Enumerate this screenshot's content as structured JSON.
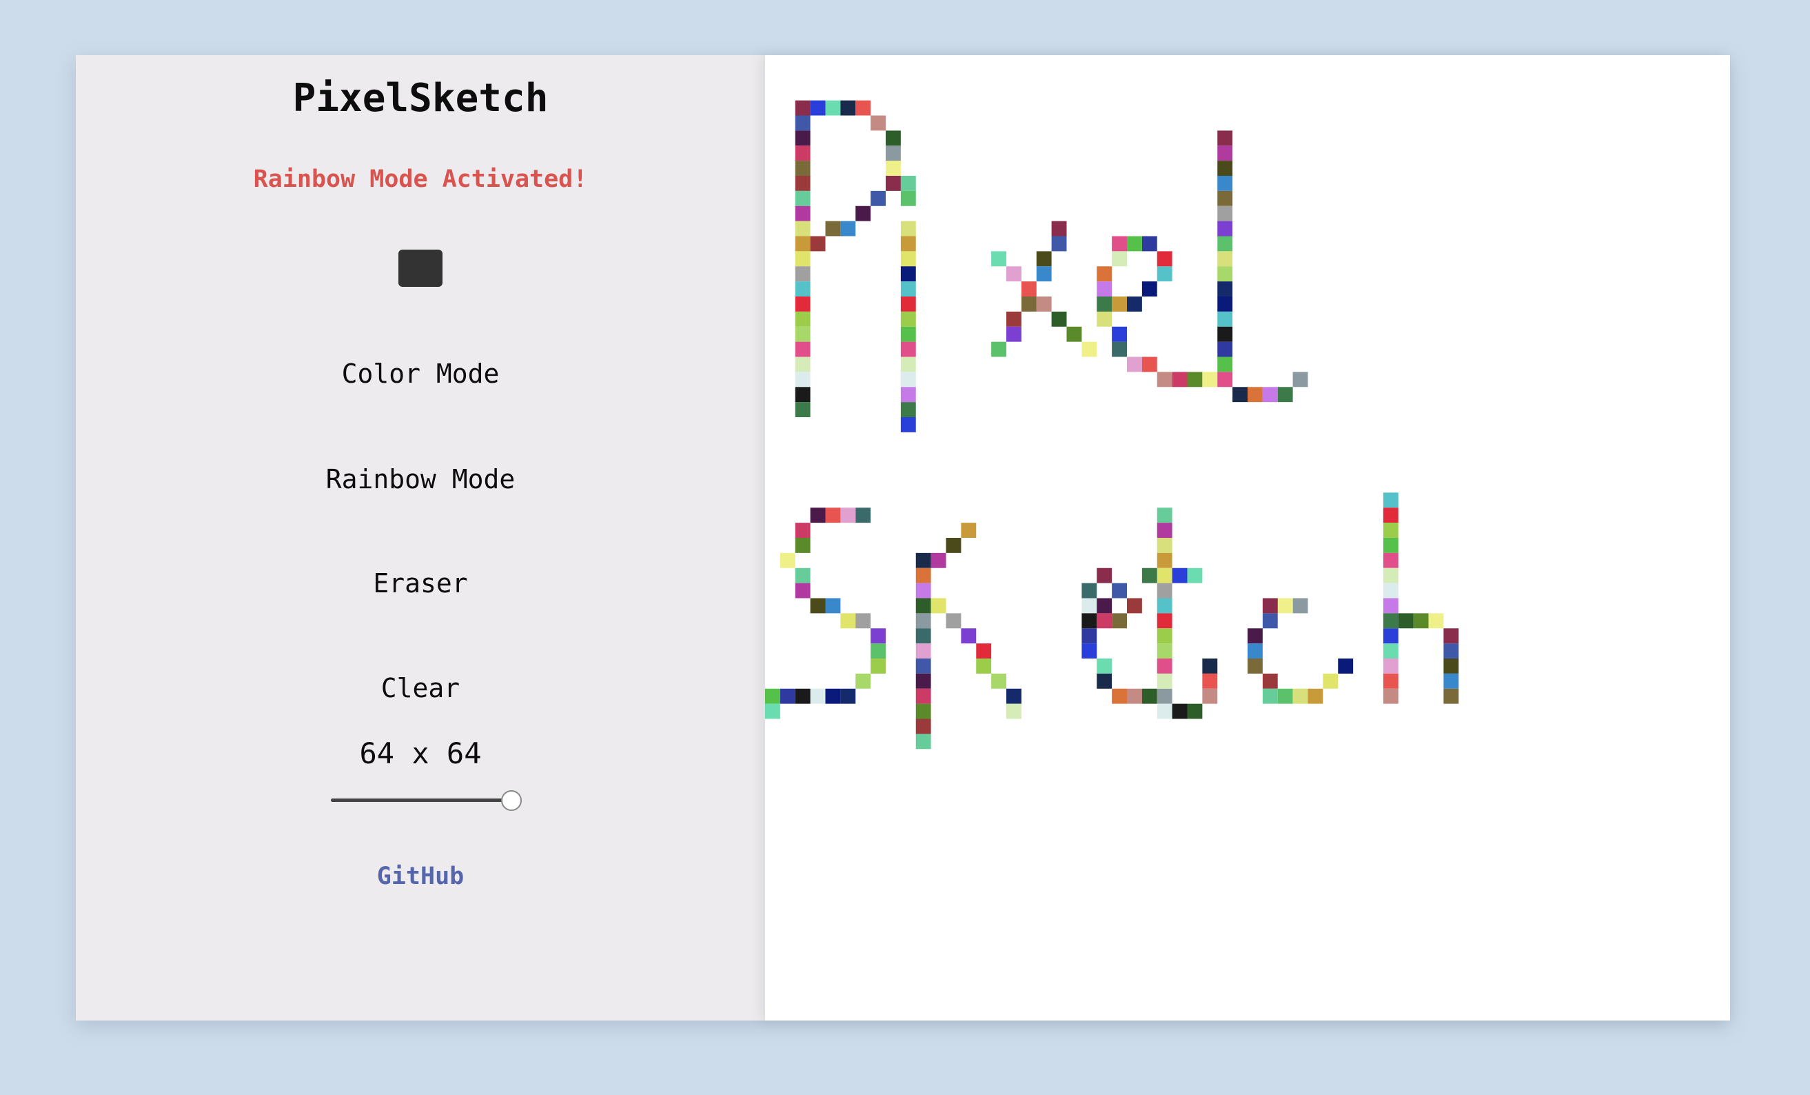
{
  "app": {
    "title": "PixelSketch",
    "status": "Rainbow Mode Activated!"
  },
  "controls": {
    "current_color": "#333333",
    "buttons": {
      "color_mode": "Color Mode",
      "rainbow_mode": "Rainbow Mode",
      "eraser": "Eraser",
      "clear": "Clear"
    },
    "grid_size_label": "64 x 64",
    "grid_size": {
      "value": 64,
      "min": 1,
      "max": 64
    },
    "github_label": "GitHub"
  },
  "canvas": {
    "grid": 64,
    "background": "#ffffff",
    "drawing_text": "Pixel Sketch",
    "palette": [
      "#8a2c4b",
      "#66cc99",
      "#7b3fd1",
      "#55c1c8",
      "#dcecec",
      "#d9733a",
      "#e8544f",
      "#3f59a8",
      "#b13aa0",
      "#5cc16b",
      "#e22b3a",
      "#1b1a1a",
      "#c57ae8",
      "#c48a84",
      "#4a1a4a",
      "#4b4a1a",
      "#d7e07a",
      "#9bcc4a",
      "#2f3aa0",
      "#3c7a4a",
      "#2d5e2a",
      "#cc3a66",
      "#3a88cc",
      "#c89a3a",
      "#a8d86a",
      "#55c14a",
      "#2a3fd9",
      "#8a9aa0",
      "#5a8a2a",
      "#7a6a3a",
      "#e0e46a",
      "#142a6a",
      "#e04f8a",
      "#6adcb0",
      "#3a6a6a",
      "#f0f08a",
      "#9a3a3a",
      "#a0a0a0",
      "#0a1a7a",
      "#d6ecb8",
      "#1a2a4a",
      "#e0a0d0"
    ]
  }
}
